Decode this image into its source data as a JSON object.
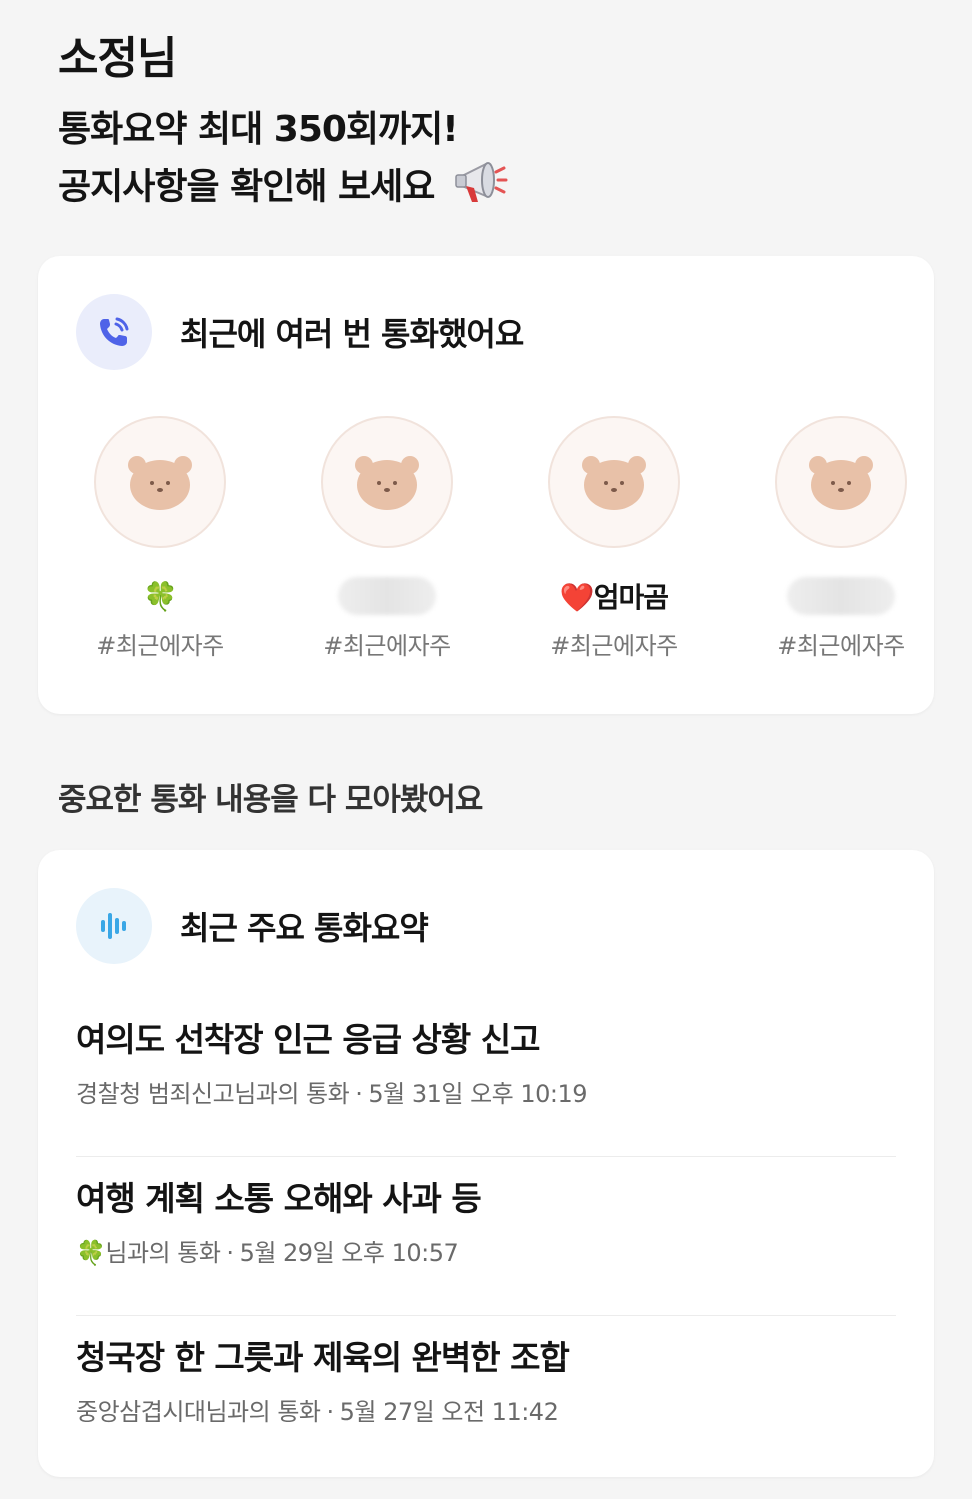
{
  "greeting": "소정님",
  "notice": {
    "line1": "통화요약 최대 350회까지!",
    "line2": "공지사항을 확인해 보세요",
    "icon": "megaphone-icon"
  },
  "frequent_calls": {
    "title": "최근에 여러 번 통화했어요",
    "icon": "phone-icon",
    "contacts": [
      {
        "name": "🍀",
        "tag": "#최근에자주",
        "name_hidden": false
      },
      {
        "name": "",
        "tag": "#최근에자주",
        "name_hidden": true
      },
      {
        "name": "❤️엄마곰",
        "tag": "#최근에자주",
        "name_hidden": false
      },
      {
        "name": "",
        "tag": "#최근에자주",
        "name_hidden": true
      }
    ]
  },
  "section_title": "중요한 통화 내용을 다 모아봤어요",
  "recent_summaries": {
    "title": "최근 주요 통화요약",
    "icon": "audio-wave-icon",
    "items": [
      {
        "title": "여의도 선착장 인근 응급 상황 신고",
        "caller": "경찰청 범죄신고님과의 통화",
        "date": "5월 31일 오후 10:19"
      },
      {
        "title": "여행 계획 소통 오해와 사과 등",
        "caller": "🍀님과의 통화",
        "date": "5월 29일 오후 10:57"
      },
      {
        "title": "청국장 한 그릇과 제육의 완벽한 조합",
        "caller": "중앙삼겹시대님과의 통화",
        "date": "5월 27일 오전 11:42"
      }
    ]
  },
  "colors": {
    "background": "#f5f5f5",
    "card": "#ffffff",
    "phone_icon": "#4f63e8",
    "wave_icon": "#3aa7e6",
    "avatar_bg": "#fcf6f3",
    "bear": "#e8c1a8"
  }
}
